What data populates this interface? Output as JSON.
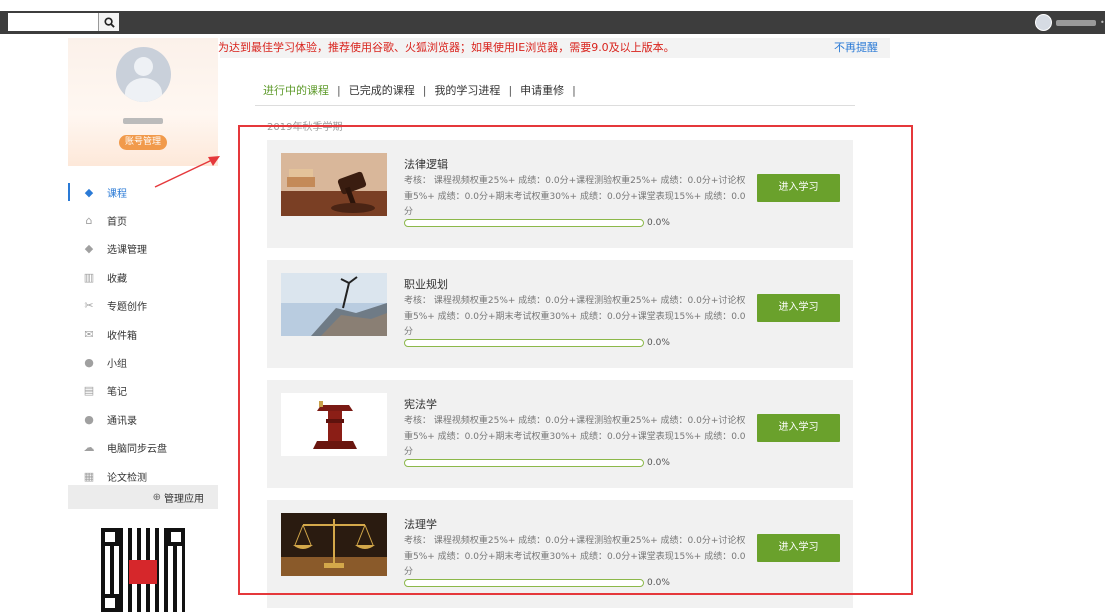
{
  "topbar": {
    "search_icon": "search-icon",
    "user_avatar_icon": "avatar-icon"
  },
  "notice": {
    "text": "为达到最佳学习体验，推荐使用谷歌、火狐浏览器；如果使用IE浏览器，需要9.0及以上版本。",
    "close_label": "不再提醒"
  },
  "profile": {
    "account_button": "账号管理"
  },
  "nav": {
    "items": [
      {
        "label": "课程",
        "icon": "course-icon",
        "glyph": "◆",
        "active": true
      },
      {
        "label": "首页",
        "icon": "home-icon",
        "glyph": "⌂"
      },
      {
        "label": "选课管理",
        "icon": "course-select-icon",
        "glyph": "◆"
      },
      {
        "label": "收藏",
        "icon": "bookmark-icon",
        "glyph": "▥"
      },
      {
        "label": "专题创作",
        "icon": "tools-icon",
        "glyph": "✂"
      },
      {
        "label": "收件箱",
        "icon": "inbox-icon",
        "glyph": "✉"
      },
      {
        "label": "小组",
        "icon": "group-icon",
        "glyph": "●"
      },
      {
        "label": "笔记",
        "icon": "note-icon",
        "glyph": "▤"
      },
      {
        "label": "通讯录",
        "icon": "contacts-icon",
        "glyph": "●"
      },
      {
        "label": "电脑同步云盘",
        "icon": "cloud-icon",
        "glyph": "☁"
      },
      {
        "label": "论文检测",
        "icon": "paper-check-icon",
        "glyph": "▦"
      }
    ],
    "manage_apps": "管理应用"
  },
  "tabs": {
    "in_progress": "进行中的课程",
    "completed": "已完成的课程",
    "progress": "我的学习进程",
    "retake": "申请重修",
    "separator": "|"
  },
  "semester": "2019年秋季学期",
  "courses": [
    {
      "title": "法律逻辑",
      "description": "考核： 课程视频权重25%+ 成绩：0.0分+课程测验权重25%+ 成绩：0.0分+讨论权重5%+ 成绩：0.0分+期末考试权重30%+ 成绩：0.0分+课堂表现15%+ 成绩：0.0分",
      "progress": 0.0,
      "progress_text": "0.0%",
      "button": "进入学习"
    },
    {
      "title": "职业规划",
      "description": "考核： 课程视频权重25%+ 成绩：0.0分+课程测验权重25%+ 成绩：0.0分+讨论权重5%+ 成绩：0.0分+期末考试权重30%+ 成绩：0.0分+课堂表现15%+ 成绩：0.0分",
      "progress": 0.0,
      "progress_text": "0.0%",
      "button": "进入学习"
    },
    {
      "title": "宪法学",
      "description": "考核： 课程视频权重25%+ 成绩：0.0分+课程测验权重25%+ 成绩：0.0分+讨论权重5%+ 成绩：0.0分+期末考试权重30%+ 成绩：0.0分+课堂表现15%+ 成绩：0.0分",
      "progress": 0.0,
      "progress_text": "0.0%",
      "button": "进入学习"
    },
    {
      "title": "法理学",
      "description": "考核： 课程视频权重25%+ 成绩：0.0分+课程测验权重25%+ 成绩：0.0分+讨论权重5%+ 成绩：0.0分+期末考试权重30%+ 成绩：0.0分+课堂表现15%+ 成绩：0.0分",
      "progress": 0.0,
      "progress_text": "0.0%",
      "button": "进入学习"
    }
  ],
  "colors": {
    "accent_green": "#6aa12c",
    "link_blue": "#2a7ad6",
    "notice_red": "#d9231d",
    "annotation_red": "#e5383b"
  }
}
